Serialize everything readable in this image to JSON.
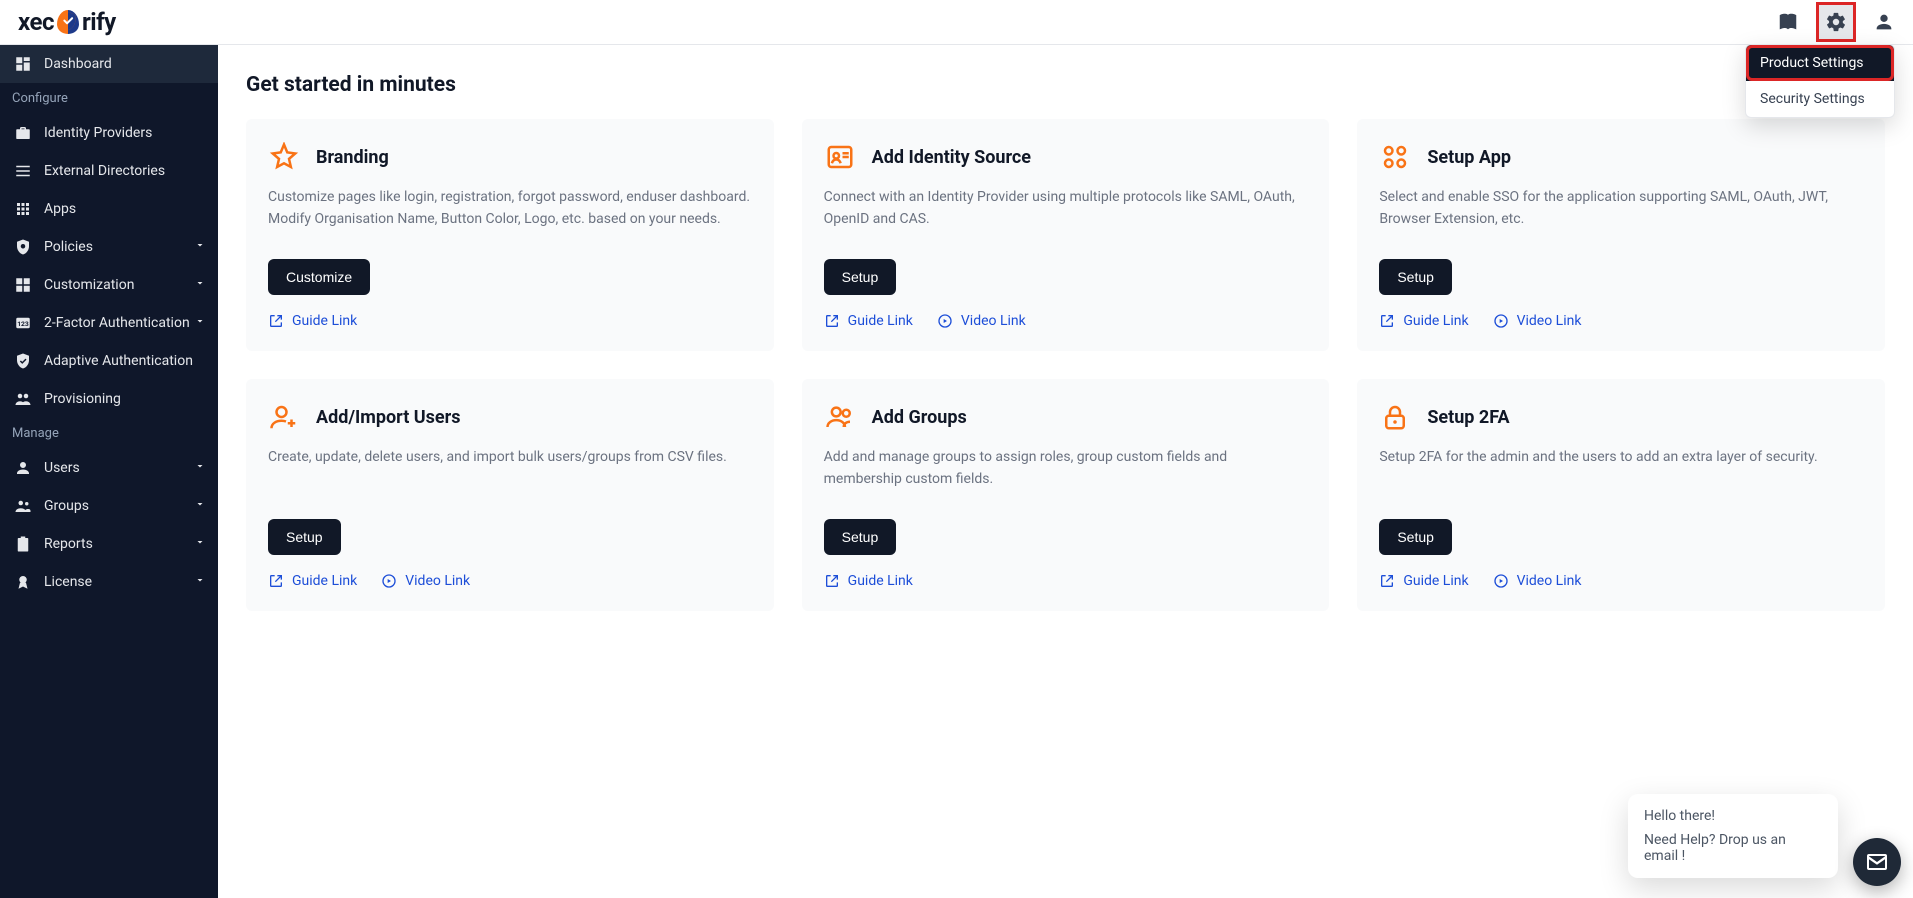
{
  "brand": {
    "name_left": "xec",
    "name_right": "rify"
  },
  "settings_menu": {
    "items": [
      "Product Settings",
      "Security Settings"
    ],
    "active_index": 0
  },
  "sidebar": {
    "sections": [
      {
        "label": "Configure",
        "items": [
          {
            "label": "Dashboard",
            "active": true,
            "expandable": false,
            "icon": "dashboard"
          },
          {
            "label": "Identity Providers",
            "expandable": false,
            "icon": "idp"
          },
          {
            "label": "External Directories",
            "expandable": false,
            "icon": "extdir"
          },
          {
            "label": "Apps",
            "expandable": false,
            "icon": "apps"
          },
          {
            "label": "Policies",
            "expandable": true,
            "icon": "policies"
          },
          {
            "label": "Customization",
            "expandable": true,
            "icon": "customization"
          },
          {
            "label": "2-Factor Authentication",
            "expandable": true,
            "icon": "2fa"
          },
          {
            "label": "Adaptive Authentication",
            "expandable": false,
            "icon": "adaptive"
          },
          {
            "label": "Provisioning",
            "expandable": false,
            "icon": "provisioning"
          }
        ]
      },
      {
        "label": "Manage",
        "items": [
          {
            "label": "Users",
            "expandable": true,
            "icon": "users"
          },
          {
            "label": "Groups",
            "expandable": true,
            "icon": "groups"
          },
          {
            "label": "Reports",
            "expandable": true,
            "icon": "reports"
          },
          {
            "label": "License",
            "expandable": true,
            "icon": "license"
          }
        ]
      }
    ]
  },
  "page": {
    "title": "Get started in minutes"
  },
  "cards": [
    {
      "title": "Branding",
      "desc": "Customize pages like login, registration, forgot password, enduser dashboard. Modify Organisation Name, Button Color, Logo, etc. based on your needs.",
      "button": "Customize",
      "guide": "Guide Link",
      "video": null,
      "icon": "star"
    },
    {
      "title": "Add Identity Source",
      "desc": "Connect with an Identity Provider using multiple protocols like SAML, OAuth, OpenID and CAS.",
      "button": "Setup",
      "guide": "Guide Link",
      "video": "Video Link",
      "icon": "id"
    },
    {
      "title": "Setup App",
      "desc": "Select and enable SSO for the application supporting SAML, OAuth, JWT, Browser Extension, etc.",
      "button": "Setup",
      "guide": "Guide Link",
      "video": "Video Link",
      "icon": "apps"
    },
    {
      "title": "Add/Import Users",
      "desc": "Create, update, delete users, and import bulk users/groups from CSV files.",
      "button": "Setup",
      "guide": "Guide Link",
      "video": "Video Link",
      "icon": "useradd"
    },
    {
      "title": "Add Groups",
      "desc": "Add and manage groups to assign roles, group custom fields and membership custom fields.",
      "button": "Setup",
      "guide": "Guide Link",
      "video": null,
      "icon": "group"
    },
    {
      "title": "Setup 2FA",
      "desc": "Setup 2FA for the admin and the users to add an extra layer of security.",
      "button": "Setup",
      "guide": "Guide Link",
      "video": "Video Link",
      "icon": "lock"
    }
  ],
  "chat": {
    "line1": "Hello there!",
    "line2": "Need Help? Drop us an email !"
  }
}
